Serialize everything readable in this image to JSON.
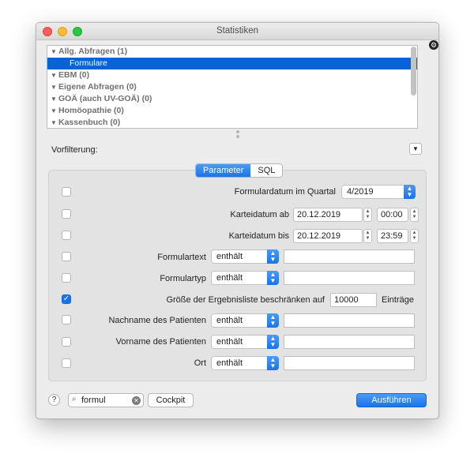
{
  "window": {
    "title": "Statistiken"
  },
  "tree": {
    "items": [
      {
        "label": "Allg. Abfragen (1)",
        "expanded": true
      },
      {
        "label": "Formulare",
        "selected": true
      },
      {
        "label": "EBM (0)",
        "expanded": true
      },
      {
        "label": "Eigene Abfragen (0)",
        "expanded": true
      },
      {
        "label": "GOÄ (auch UV-GOÄ) (0)",
        "expanded": true
      },
      {
        "label": "Homöopathie (0)",
        "expanded": true
      },
      {
        "label": "Kassenbuch (0)",
        "expanded": true
      }
    ]
  },
  "prefilter": {
    "label": "Vorfilterung:"
  },
  "tabs": [
    {
      "label": "Parameter",
      "active": true
    },
    {
      "label": "SQL",
      "active": false
    }
  ],
  "params": {
    "quarter": {
      "label": "Formulardatum im Quartal",
      "value": "4/2019",
      "checked": false
    },
    "date_from": {
      "label": "Karteidatum ab",
      "date": "20.12.2019",
      "time": "00:00",
      "checked": false
    },
    "date_to": {
      "label": "Karteidatum bis",
      "date": "20.12.2019",
      "time": "23:59",
      "checked": false
    },
    "form_text": {
      "label": "Formulartext",
      "op": "enthält",
      "value": "",
      "checked": false
    },
    "form_type": {
      "label": "Formulartyp",
      "op": "enthält",
      "value": "",
      "checked": false
    },
    "limit": {
      "label": "Größe der Ergebnisliste beschränken auf",
      "value": "10000",
      "unit": "Einträge",
      "checked": true
    },
    "last_name": {
      "label": "Nachname des Patienten",
      "op": "enthält",
      "value": "",
      "checked": false
    },
    "first_name": {
      "label": "Vorname des Patienten",
      "op": "enthält",
      "value": "",
      "checked": false
    },
    "city": {
      "label": "Ort",
      "op": "enthält",
      "value": "",
      "checked": false
    }
  },
  "footer": {
    "help": "?",
    "search_value": "formul",
    "cockpit": "Cockpit",
    "run": "Ausführen"
  },
  "colors": {
    "accent": "#1a73e8",
    "selection": "#0963d7"
  }
}
